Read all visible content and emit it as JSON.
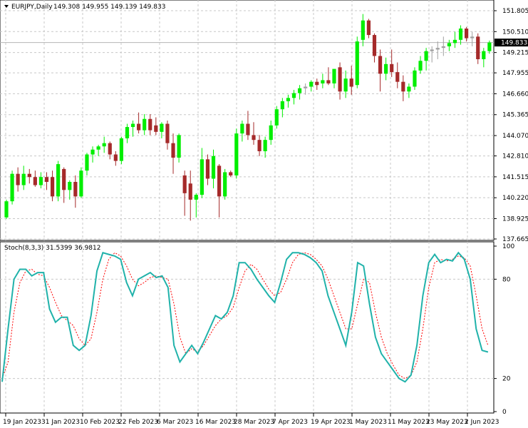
{
  "window": {
    "symbol_title": "EURJPY,Daily",
    "ohlc_text": "149.308 149.955 149.139 149.833",
    "arrow_icon": "triangle-down-icon"
  },
  "price_panel": {
    "y_ticks": [
      "151.805",
      "150.510",
      "149.215",
      "147.955",
      "146.660",
      "145.365",
      "144.070",
      "142.810",
      "141.515",
      "140.220",
      "138.925",
      "137.665"
    ],
    "current_price": "149.833",
    "current_price_value": 149.833,
    "y_range": [
      137.665,
      151.805
    ],
    "colors": {
      "bull": "#00ee00",
      "bear": "#a52a2a",
      "neutral": "#a0a0a0",
      "price_line": "#b4b4b4"
    }
  },
  "stoch_panel": {
    "label": "Stoch(8,3,3) 31.5399 36.9812",
    "y_ticks": [
      "100",
      "80",
      "20",
      "0"
    ],
    "colors": {
      "main": "#20b2aa",
      "signal": "#ff0000"
    }
  },
  "x_axis": {
    "labels": [
      "19 Jan 2023",
      "31 Jan 2023",
      "10 Feb 2023",
      "22 Feb 2023",
      "6 Mar 2023",
      "16 Mar 2023",
      "28 Mar 2023",
      "7 Apr 2023",
      "19 Apr 2023",
      "1 May 2023",
      "11 May 2023",
      "23 May 2023",
      "2 Jun 2023"
    ]
  },
  "chart_data": {
    "type": "candlestick",
    "grid": true,
    "candles": [
      {
        "o": 139.0,
        "h": 140.1,
        "l": 138.9,
        "c": 140.0
      },
      {
        "o": 140.0,
        "h": 141.9,
        "l": 139.8,
        "c": 141.7
      },
      {
        "o": 141.7,
        "h": 142.1,
        "l": 140.6,
        "c": 141.0
      },
      {
        "o": 141.0,
        "h": 142.2,
        "l": 140.7,
        "c": 141.7
      },
      {
        "o": 141.7,
        "h": 142.0,
        "l": 141.1,
        "c": 141.5
      },
      {
        "o": 141.5,
        "h": 141.9,
        "l": 140.9,
        "c": 141.0
      },
      {
        "o": 141.0,
        "h": 141.8,
        "l": 140.8,
        "c": 141.5
      },
      {
        "o": 141.5,
        "h": 141.8,
        "l": 140.7,
        "c": 141.2
      },
      {
        "o": 141.5,
        "h": 141.9,
        "l": 140.0,
        "c": 140.3
      },
      {
        "o": 140.3,
        "h": 142.5,
        "l": 140.0,
        "c": 142.3
      },
      {
        "o": 142.0,
        "h": 142.1,
        "l": 139.9,
        "c": 140.7
      },
      {
        "o": 140.7,
        "h": 141.3,
        "l": 140.1,
        "c": 141.2
      },
      {
        "o": 141.2,
        "h": 141.6,
        "l": 139.6,
        "c": 140.3
      },
      {
        "o": 140.3,
        "h": 142.1,
        "l": 140.2,
        "c": 141.9
      },
      {
        "o": 141.9,
        "h": 143.0,
        "l": 141.6,
        "c": 142.9
      },
      {
        "o": 142.9,
        "h": 143.4,
        "l": 142.4,
        "c": 143.2
      },
      {
        "o": 143.2,
        "h": 143.5,
        "l": 142.8,
        "c": 143.4
      },
      {
        "o": 143.4,
        "h": 144.0,
        "l": 143.0,
        "c": 143.6
      },
      {
        "o": 143.6,
        "h": 143.7,
        "l": 142.6,
        "c": 142.9
      },
      {
        "o": 142.9,
        "h": 143.1,
        "l": 142.2,
        "c": 142.5
      },
      {
        "o": 142.5,
        "h": 144.0,
        "l": 142.3,
        "c": 143.9
      },
      {
        "o": 143.9,
        "h": 144.8,
        "l": 143.6,
        "c": 144.6
      },
      {
        "o": 144.6,
        "h": 145.0,
        "l": 144.0,
        "c": 144.8
      },
      {
        "o": 144.8,
        "h": 145.5,
        "l": 144.2,
        "c": 144.4
      },
      {
        "o": 144.4,
        "h": 145.4,
        "l": 144.1,
        "c": 145.1
      },
      {
        "o": 145.1,
        "h": 145.4,
        "l": 144.1,
        "c": 144.4
      },
      {
        "o": 144.7,
        "h": 145.2,
        "l": 144.1,
        "c": 144.3
      },
      {
        "o": 144.3,
        "h": 144.9,
        "l": 143.9,
        "c": 144.8
      },
      {
        "o": 144.8,
        "h": 145.0,
        "l": 143.2,
        "c": 143.6
      },
      {
        "o": 143.6,
        "h": 144.2,
        "l": 141.7,
        "c": 142.7
      },
      {
        "o": 142.7,
        "h": 144.2,
        "l": 142.4,
        "c": 144.1
      },
      {
        "o": 141.6,
        "h": 141.9,
        "l": 139.1,
        "c": 140.5
      },
      {
        "o": 141.1,
        "h": 141.9,
        "l": 138.8,
        "c": 140.1
      },
      {
        "o": 140.1,
        "h": 140.5,
        "l": 139.0,
        "c": 140.4
      },
      {
        "o": 140.4,
        "h": 143.3,
        "l": 140.2,
        "c": 142.6
      },
      {
        "o": 142.6,
        "h": 142.9,
        "l": 141.0,
        "c": 141.4
      },
      {
        "o": 141.4,
        "h": 143.2,
        "l": 140.8,
        "c": 142.8
      },
      {
        "o": 142.2,
        "h": 142.3,
        "l": 139.0,
        "c": 140.3
      },
      {
        "o": 140.3,
        "h": 142.0,
        "l": 140.1,
        "c": 141.8
      },
      {
        "o": 141.8,
        "h": 141.9,
        "l": 141.5,
        "c": 141.6
      },
      {
        "o": 141.6,
        "h": 144.5,
        "l": 141.4,
        "c": 144.2
      },
      {
        "o": 144.2,
        "h": 145.0,
        "l": 143.7,
        "c": 144.8
      },
      {
        "o": 144.8,
        "h": 145.6,
        "l": 143.8,
        "c": 144.1
      },
      {
        "o": 144.1,
        "h": 144.9,
        "l": 143.5,
        "c": 143.8
      },
      {
        "o": 143.8,
        "h": 144.1,
        "l": 142.8,
        "c": 143.1
      },
      {
        "o": 143.1,
        "h": 144.0,
        "l": 142.7,
        "c": 143.8
      },
      {
        "o": 143.8,
        "h": 145.0,
        "l": 143.5,
        "c": 144.7
      },
      {
        "o": 144.7,
        "h": 145.9,
        "l": 144.5,
        "c": 145.7
      },
      {
        "o": 145.7,
        "h": 146.4,
        "l": 145.2,
        "c": 146.2
      },
      {
        "o": 146.2,
        "h": 146.6,
        "l": 145.8,
        "c": 146.4
      },
      {
        "o": 146.4,
        "h": 146.9,
        "l": 146.0,
        "c": 146.7
      },
      {
        "o": 146.7,
        "h": 147.2,
        "l": 146.3,
        "c": 147.0
      },
      {
        "o": 147.0,
        "h": 147.3,
        "l": 146.6,
        "c": 147.1
      },
      {
        "o": 147.1,
        "h": 147.5,
        "l": 146.8,
        "c": 147.4
      },
      {
        "o": 147.4,
        "h": 147.6,
        "l": 146.9,
        "c": 147.2
      },
      {
        "o": 147.3,
        "h": 147.9,
        "l": 147.0,
        "c": 147.5
      },
      {
        "o": 147.5,
        "h": 148.3,
        "l": 147.2,
        "c": 147.3
      },
      {
        "o": 147.3,
        "h": 148.0,
        "l": 147.0,
        "c": 148.2
      },
      {
        "o": 148.3,
        "h": 148.6,
        "l": 146.3,
        "c": 146.8
      },
      {
        "o": 146.8,
        "h": 148.1,
        "l": 146.4,
        "c": 147.6
      },
      {
        "o": 147.6,
        "h": 148.4,
        "l": 146.6,
        "c": 147.1
      },
      {
        "o": 147.2,
        "h": 150.2,
        "l": 147.0,
        "c": 149.9
      },
      {
        "o": 150.0,
        "h": 151.6,
        "l": 149.6,
        "c": 151.2
      },
      {
        "o": 151.2,
        "h": 151.3,
        "l": 150.1,
        "c": 150.3
      },
      {
        "o": 150.3,
        "h": 150.4,
        "l": 148.6,
        "c": 149.0
      },
      {
        "o": 149.0,
        "h": 149.4,
        "l": 146.8,
        "c": 147.9
      },
      {
        "o": 147.9,
        "h": 148.9,
        "l": 147.5,
        "c": 148.5
      },
      {
        "o": 148.5,
        "h": 149.4,
        "l": 147.7,
        "c": 148.0
      },
      {
        "o": 148.0,
        "h": 148.6,
        "l": 147.0,
        "c": 147.4
      },
      {
        "o": 147.4,
        "h": 147.8,
        "l": 146.2,
        "c": 146.8
      },
      {
        "o": 146.8,
        "h": 147.3,
        "l": 146.4,
        "c": 147.1
      },
      {
        "o": 147.1,
        "h": 148.3,
        "l": 146.9,
        "c": 148.1
      },
      {
        "o": 148.1,
        "h": 149.0,
        "l": 147.9,
        "c": 148.7
      },
      {
        "o": 148.7,
        "h": 149.5,
        "l": 148.1,
        "c": 149.3
      },
      {
        "o": 149.3,
        "h": 149.6,
        "l": 148.6,
        "c": 149.4
      },
      {
        "o": 149.4,
        "h": 149.9,
        "l": 148.8,
        "c": 149.5
      },
      {
        "o": 149.5,
        "h": 150.2,
        "l": 149.0,
        "c": 149.6
      },
      {
        "o": 149.6,
        "h": 150.0,
        "l": 149.3,
        "c": 149.8
      },
      {
        "o": 149.8,
        "h": 150.5,
        "l": 149.5,
        "c": 150.0
      },
      {
        "o": 150.0,
        "h": 150.9,
        "l": 149.7,
        "c": 150.7
      },
      {
        "o": 150.7,
        "h": 150.8,
        "l": 149.9,
        "c": 150.1
      },
      {
        "o": 150.1,
        "h": 150.5,
        "l": 149.6,
        "c": 150.2
      },
      {
        "o": 150.2,
        "h": 150.4,
        "l": 148.5,
        "c": 148.8
      },
      {
        "o": 148.8,
        "h": 149.5,
        "l": 148.3,
        "c": 149.3
      },
      {
        "o": 149.3,
        "h": 149.955,
        "l": 149.139,
        "c": 149.833
      }
    ],
    "stochastic": {
      "main": [
        18,
        50,
        80,
        86,
        86,
        82,
        84,
        84,
        62,
        54,
        57,
        57,
        40,
        37,
        40,
        58,
        85,
        96,
        95,
        94,
        92,
        78,
        70,
        80,
        82,
        84,
        81,
        82,
        75,
        40,
        30,
        35,
        40,
        35,
        42,
        50,
        58,
        56,
        60,
        70,
        90,
        90,
        86,
        80,
        75,
        70,
        66,
        78,
        92,
        96,
        96,
        95,
        93,
        90,
        85,
        70,
        60,
        50,
        40,
        60,
        90,
        88,
        65,
        45,
        35,
        30,
        25,
        20,
        18,
        22,
        40,
        70,
        90,
        95,
        90,
        92,
        91,
        96,
        92,
        80,
        50,
        37,
        36
      ],
      "signal": [
        20,
        30,
        60,
        78,
        85,
        86,
        83,
        82,
        75,
        66,
        58,
        55,
        52,
        44,
        40,
        44,
        60,
        80,
        92,
        96,
        94,
        88,
        80,
        76,
        78,
        81,
        82,
        81,
        80,
        65,
        45,
        35,
        38,
        36,
        40,
        46,
        52,
        56,
        58,
        63,
        75,
        85,
        89,
        86,
        80,
        74,
        70,
        72,
        80,
        90,
        95,
        96,
        95,
        92,
        88,
        80,
        70,
        60,
        50,
        50,
        65,
        80,
        78,
        60,
        45,
        35,
        28,
        22,
        20,
        22,
        30,
        50,
        75,
        90,
        92,
        91,
        92,
        94,
        93,
        88,
        70,
        50,
        40
      ]
    },
    "stochastic_range": [
      0,
      100
    ]
  }
}
